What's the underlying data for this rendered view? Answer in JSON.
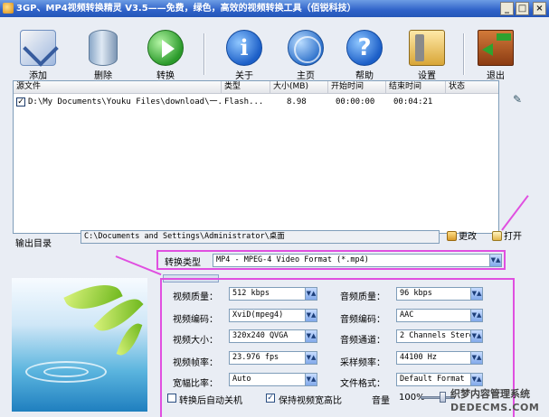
{
  "window": {
    "title": "3GP、MP4视频转换精灵 V3.5——免费，绿色，高效的视频转换工具（佰锐科技）",
    "controls": [
      "_",
      "□",
      "×"
    ]
  },
  "toolbar": [
    {
      "label": "添加",
      "icon": "folder-add-icon"
    },
    {
      "label": "删除",
      "icon": "trash-can-icon"
    },
    {
      "label": "转换",
      "icon": "play-icon"
    },
    {
      "label": "关于",
      "icon": "info-icon"
    },
    {
      "label": "主页",
      "icon": "globe-icon"
    },
    {
      "label": "帮助",
      "icon": "help-icon"
    },
    {
      "label": "设置",
      "icon": "settings-tools-icon"
    },
    {
      "label": "退出",
      "icon": "exit-door-icon"
    }
  ],
  "filelist": {
    "headers": [
      "源文件",
      "类型",
      "大小(MB)",
      "开始时间",
      "结束时间",
      "状态"
    ],
    "rows": [
      {
        "checked": true,
        "file": "D:\\My Documents\\Youku Files\\download\\一...",
        "type": "Flash...",
        "size": "8.98",
        "start": "00:00:00",
        "end": "00:04:21",
        "status": ""
      }
    ]
  },
  "output": {
    "label": "输出目录",
    "path": "C:\\Documents and Settings\\Administrator\\桌面",
    "change_label": "更改",
    "open_label": "打开"
  },
  "convert_type": {
    "label": "转换类型",
    "value": "MP4 - MPEG-4 Video Format (*.mp4)"
  },
  "settings": {
    "left": [
      {
        "label": "视频质量：",
        "value": "512 kbps"
      },
      {
        "label": "视频编码：",
        "value": "XviD(mpeg4)"
      },
      {
        "label": "视频大小：",
        "value": "320x240 QVGA"
      },
      {
        "label": "视频帧率：",
        "value": "23.976 fps"
      },
      {
        "label": "宽幅比率：",
        "value": "Auto"
      }
    ],
    "right": [
      {
        "label": "音频质量：",
        "value": "96  kbps"
      },
      {
        "label": "音频编码：",
        "value": "AAC"
      },
      {
        "label": "音频通道：",
        "value": "2 Channels Stereo"
      },
      {
        "label": "采样频率：",
        "value": "44100 Hz"
      },
      {
        "label": "文件格式：",
        "value": "Default Format"
      }
    ]
  },
  "bottom": {
    "shutdown_label": "转换后自动关机",
    "shutdown_checked": false,
    "keep_ratio_label": "保持视频宽高比",
    "keep_ratio_checked": true,
    "volume_label": "音量",
    "volume_value": "100%"
  },
  "watermark": {
    "line1": "织梦内容管理系统",
    "line2": "DEDECMS.COM"
  },
  "colors": {
    "annotation": "#e04fe0",
    "titlebar": "#2f62c8",
    "panel": "#e9edf4"
  }
}
